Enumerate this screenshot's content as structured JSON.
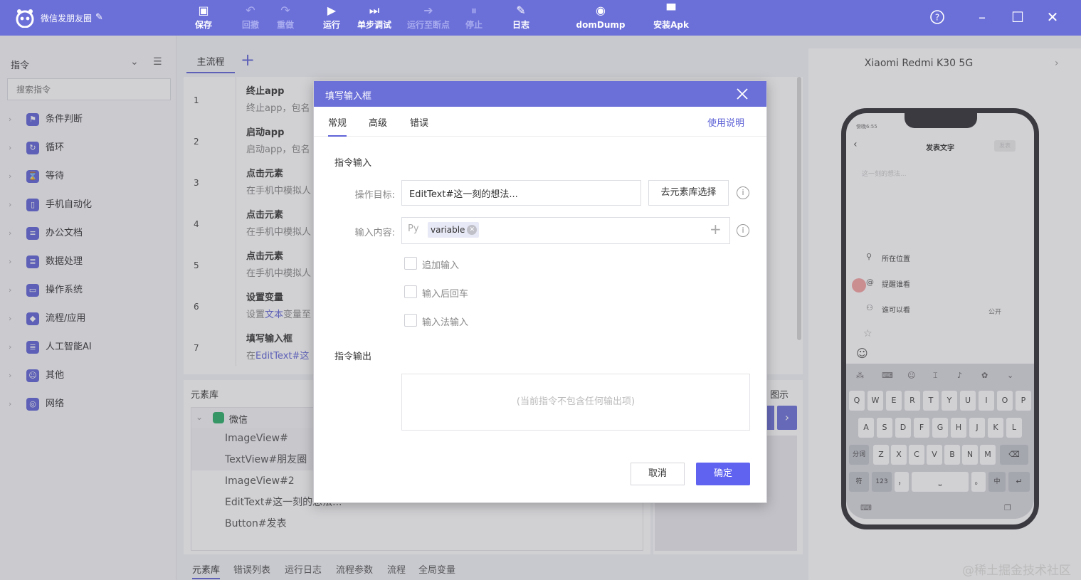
{
  "app": {
    "title": "微信发朋友圈"
  },
  "toolbar": {
    "save": "保存",
    "undo": "回撤",
    "redo": "重做",
    "run": "运行",
    "step_debug": "单步调试",
    "run_to_breakpoint": "运行至断点",
    "stop": "停止",
    "log": "日志",
    "dom_dump": "domDump",
    "install_apk": "安装Apk"
  },
  "sidebar": {
    "title": "指令",
    "search_placeholder": "搜索指令",
    "items": [
      {
        "label": "条件判断"
      },
      {
        "label": "循环"
      },
      {
        "label": "等待"
      },
      {
        "label": "手机自动化"
      },
      {
        "label": "办公文档"
      },
      {
        "label": "数据处理"
      },
      {
        "label": "操作系统"
      },
      {
        "label": "流程/应用"
      },
      {
        "label": "人工智能AI"
      },
      {
        "label": "其他"
      },
      {
        "label": "网络"
      }
    ]
  },
  "main": {
    "tab": "主流程",
    "steps": [
      {
        "num": "1",
        "title": "终止app",
        "desc": "终止app，包名"
      },
      {
        "num": "2",
        "title": "启动app",
        "desc": "启动app，包名"
      },
      {
        "num": "3",
        "title": "点击元素",
        "desc": "在手机中模拟人"
      },
      {
        "num": "4",
        "title": "点击元素",
        "desc": "在手机中模拟人"
      },
      {
        "num": "5",
        "title": "点击元素",
        "desc": "在手机中模拟人"
      },
      {
        "num": "6",
        "title": "设置变量",
        "desc_pre": "设置",
        "desc_link": "文本",
        "desc_post": "变量至"
      },
      {
        "num": "7",
        "title": "填写输入框",
        "desc_pre": "在",
        "desc_link": "EditText#这"
      }
    ]
  },
  "element_library": {
    "title": "元素库",
    "group": "微信",
    "items": [
      "ImageView#",
      "TextView#朋友圈",
      "ImageView#2",
      "EditText#这一刻的想法...",
      "Button#发表"
    ]
  },
  "preview": {
    "title": "图示"
  },
  "bottom_tabs": [
    "元素库",
    "错误列表",
    "运行日志",
    "流程参数",
    "流程",
    "全局变量"
  ],
  "device": {
    "name": "Xiaomi Redmi K30 5G",
    "status": "傍晚6:55",
    "screen_title": "发表文字",
    "publish": "发表",
    "hint": "这一刻的想法...",
    "options": [
      "所在位置",
      "提醒谁看",
      "谁可以看"
    ],
    "visibility": "公开",
    "kb_row1": [
      "Q",
      "W",
      "E",
      "R",
      "T",
      "Y",
      "U",
      "I",
      "O",
      "P"
    ],
    "kb_row2": [
      "A",
      "S",
      "D",
      "F",
      "G",
      "H",
      "J",
      "K",
      "L"
    ],
    "kb_row3": [
      "Z",
      "X",
      "C",
      "V",
      "B",
      "N",
      "M"
    ],
    "kb_fn": {
      "split": "分词",
      "sym": "符",
      "num": "123",
      "comma": "，",
      "period": "。",
      "lang": "中"
    }
  },
  "dialog": {
    "title": "填写输入框",
    "tabs": [
      "常规",
      "高级",
      "错误"
    ],
    "help": "使用说明",
    "input_section": "指令输入",
    "target_label": "操作目标:",
    "target_value": "EditText#这一刻的想法...",
    "target_button": "去元素库选择",
    "content_label": "输入内容:",
    "py": "Py",
    "variable": "variable",
    "options": [
      "追加输入",
      "输入后回车",
      "输入法输入"
    ],
    "output_section": "指令输出",
    "output_empty": "(当前指令不包含任何输出项)",
    "cancel": "取消",
    "ok": "确定"
  },
  "watermark": "@稀土掘金技术社区"
}
